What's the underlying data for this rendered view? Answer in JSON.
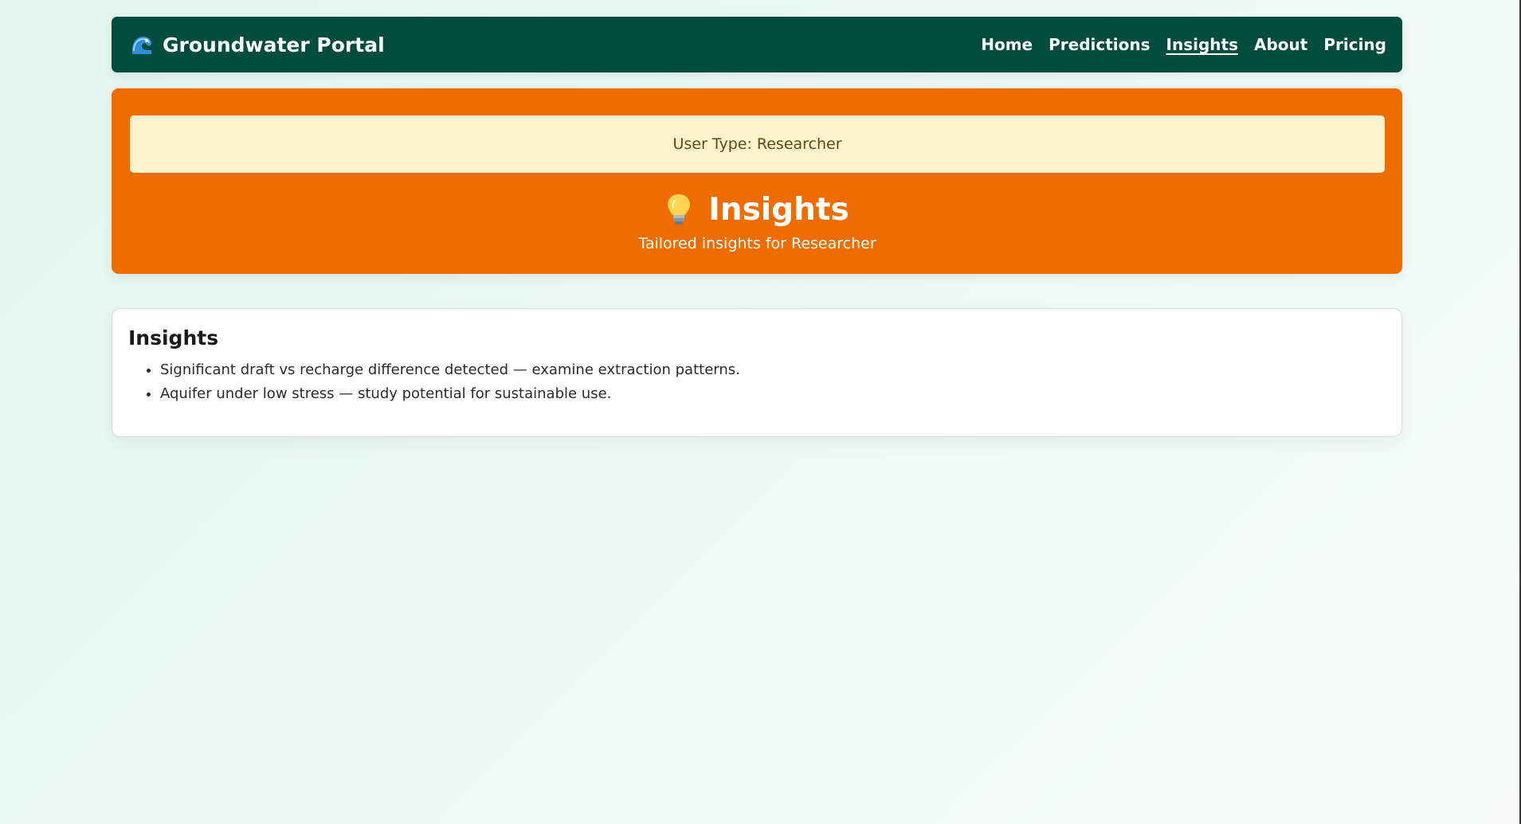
{
  "navbar": {
    "brand_icon": "wave-icon",
    "brand_title": "Groundwater Portal",
    "links": [
      {
        "label": "Home",
        "active": false
      },
      {
        "label": "Predictions",
        "active": false
      },
      {
        "label": "Insights",
        "active": true
      },
      {
        "label": "About",
        "active": false
      },
      {
        "label": "Pricing",
        "active": false
      }
    ]
  },
  "hero": {
    "user_type": "User Type: Researcher",
    "icon": "lightbulb-icon",
    "title": "Insights",
    "subtitle": "Tailored insights for Researcher"
  },
  "insights_card": {
    "title": "Insights",
    "items": [
      "Significant draft vs recharge difference detected — examine extraction patterns.",
      "Aquifer under low stress — study potential for sustainable use."
    ]
  },
  "colors": {
    "navbar_bg": "#004d40",
    "hero_bg": "#ef6c00",
    "user_type_bg": "#fff3cd",
    "page_bg": "#e2f5ee"
  }
}
